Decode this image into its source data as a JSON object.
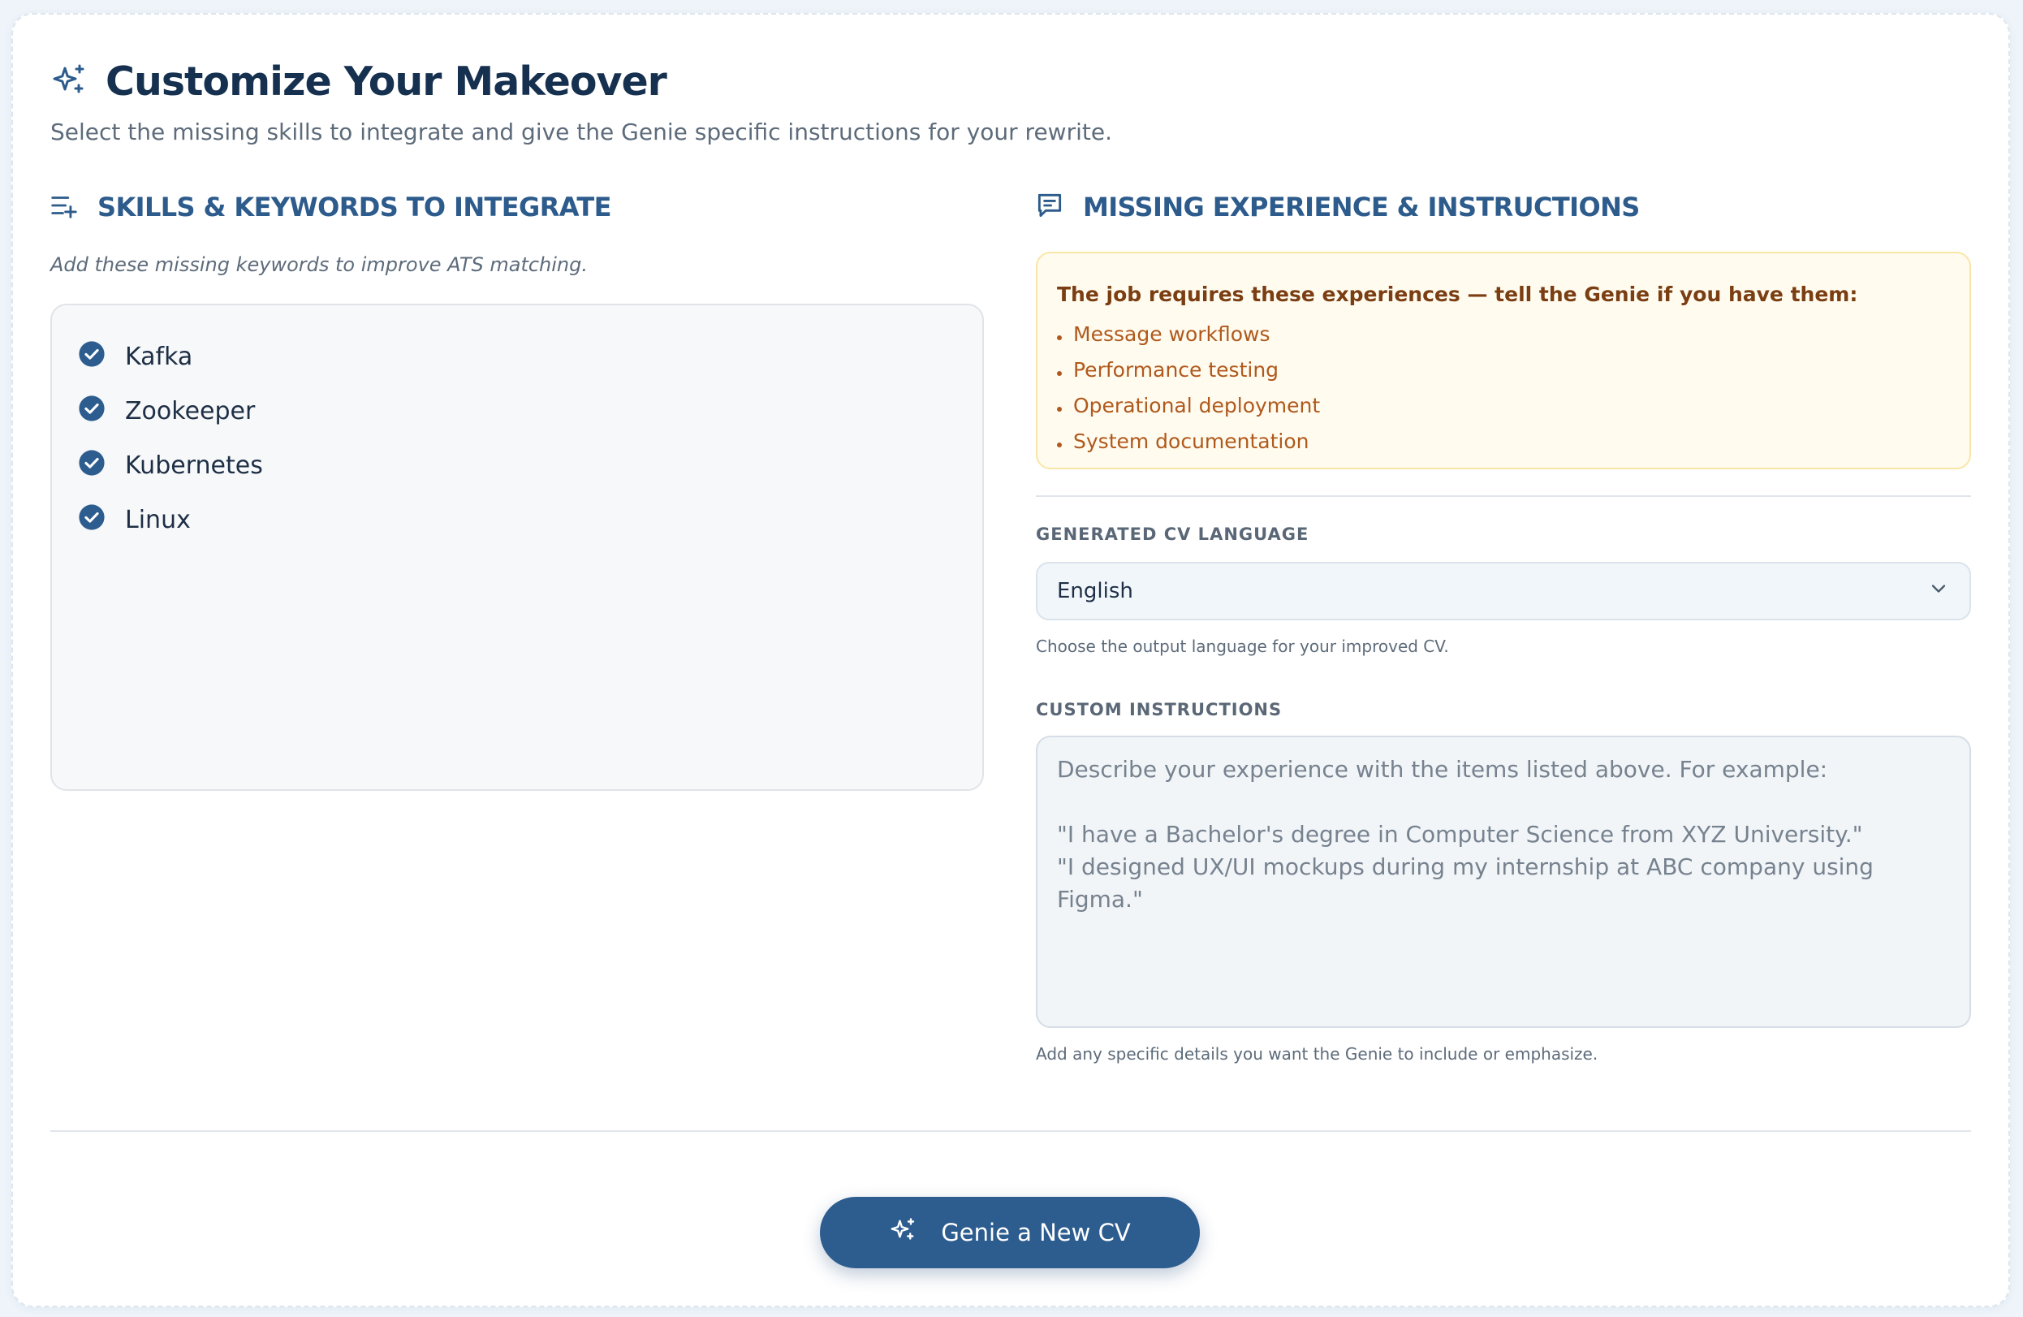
{
  "header": {
    "title": "Customize Your Makeover",
    "subtitle": "Select the missing skills to integrate and give the Genie specific instructions for your rewrite."
  },
  "skills_section": {
    "title": "SKILLS & KEYWORDS TO INTEGRATE",
    "hint": "Add these missing keywords to improve ATS matching.",
    "items": [
      {
        "label": "Kafka",
        "checked": true
      },
      {
        "label": "Zookeeper",
        "checked": true
      },
      {
        "label": "Kubernetes",
        "checked": true
      },
      {
        "label": "Linux",
        "checked": true
      }
    ]
  },
  "experience_section": {
    "title": "MISSING EXPERIENCE & INSTRUCTIONS",
    "notice_title": "The job requires these experiences — tell the Genie if you have them:",
    "experiences": [
      "Message workflows",
      "Performance testing",
      "Operational deployment",
      "System documentation"
    ]
  },
  "language": {
    "label": "GENERATED CV LANGUAGE",
    "selected": "English",
    "help": "Choose the output language for your improved CV."
  },
  "instructions": {
    "label": "CUSTOM INSTRUCTIONS",
    "placeholder": "Describe your experience with the items listed above. For example:\n\n\"I have a Bachelor's degree in Computer Science from XYZ University.\"\n\"I designed UX/UI mockups during my internship at ABC company using Figma.\"",
    "value": "",
    "help": "Add any specific details you want the Genie to include or emphasize."
  },
  "cta": {
    "label": "Genie a New CV"
  },
  "colors": {
    "primary": "#2d5d8f",
    "title": "#16304f",
    "warning_bg": "#fffbef",
    "warning_text": "#b0591c"
  },
  "icons": [
    "sparkles-icon",
    "list-add-icon",
    "chat-icon",
    "check-circle-icon",
    "chevron-down-icon"
  ]
}
